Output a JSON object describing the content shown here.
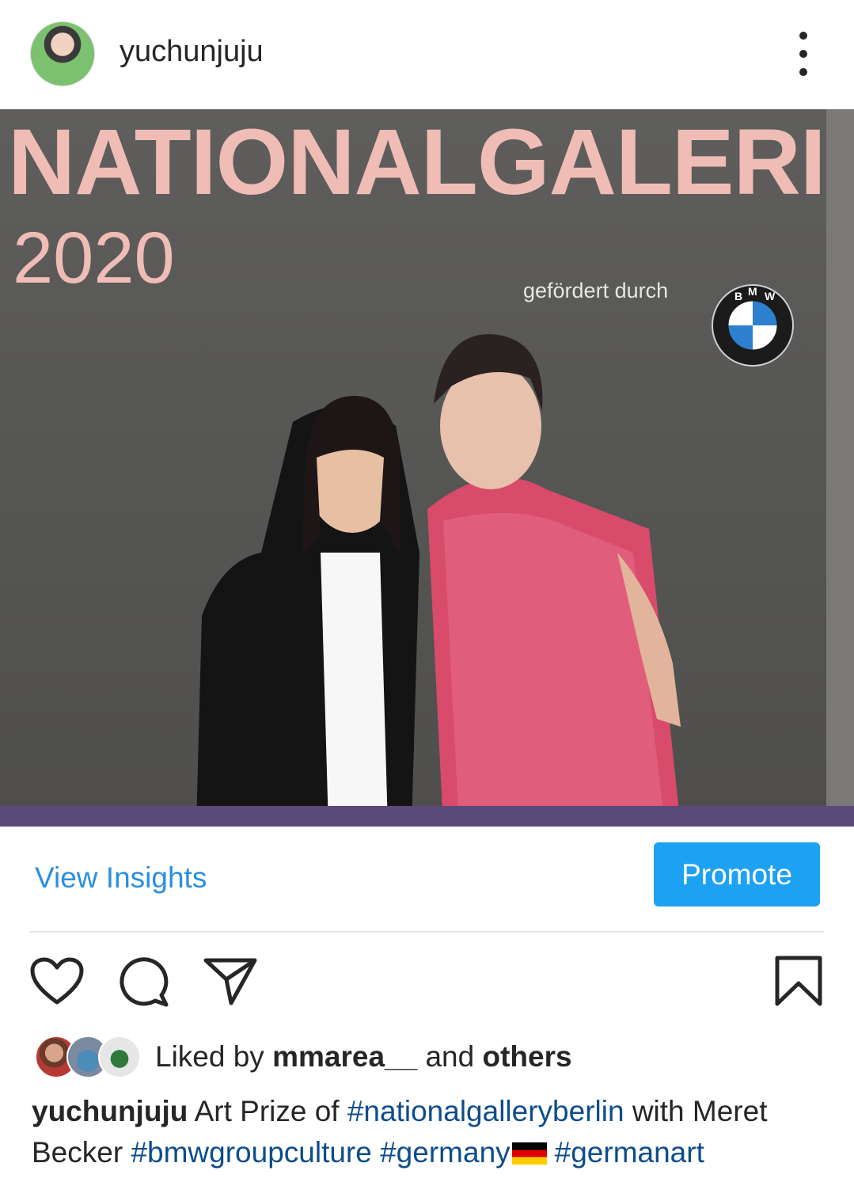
{
  "header": {
    "username": "yuchunjuju"
  },
  "photo": {
    "banner_title": "NATIONALGALERIE",
    "banner_year": "2020",
    "banner_sponsor": "gefördert durch",
    "logo_letters": "BMW"
  },
  "actions": {
    "view_insights": "View Insights",
    "promote": "Promote"
  },
  "likes": {
    "prefix": "Liked by",
    "user": "mmarea__",
    "middle": "and",
    "others": "others"
  },
  "caption": {
    "username": "yuchunjuju",
    "text1": "Art Prize of",
    "hashtag1": "#nationalgalleryberlin",
    "text2": "with Meret Becker",
    "hashtag2": "#bmwgroupculture",
    "hashtag3": "#germany",
    "hashtag4": "#germanart"
  },
  "colors": {
    "link_blue": "#2b8fe0",
    "promote_bg": "#1da1f2",
    "hashtag": "#0d4d8c",
    "banner_pink": "#efbcb6"
  }
}
